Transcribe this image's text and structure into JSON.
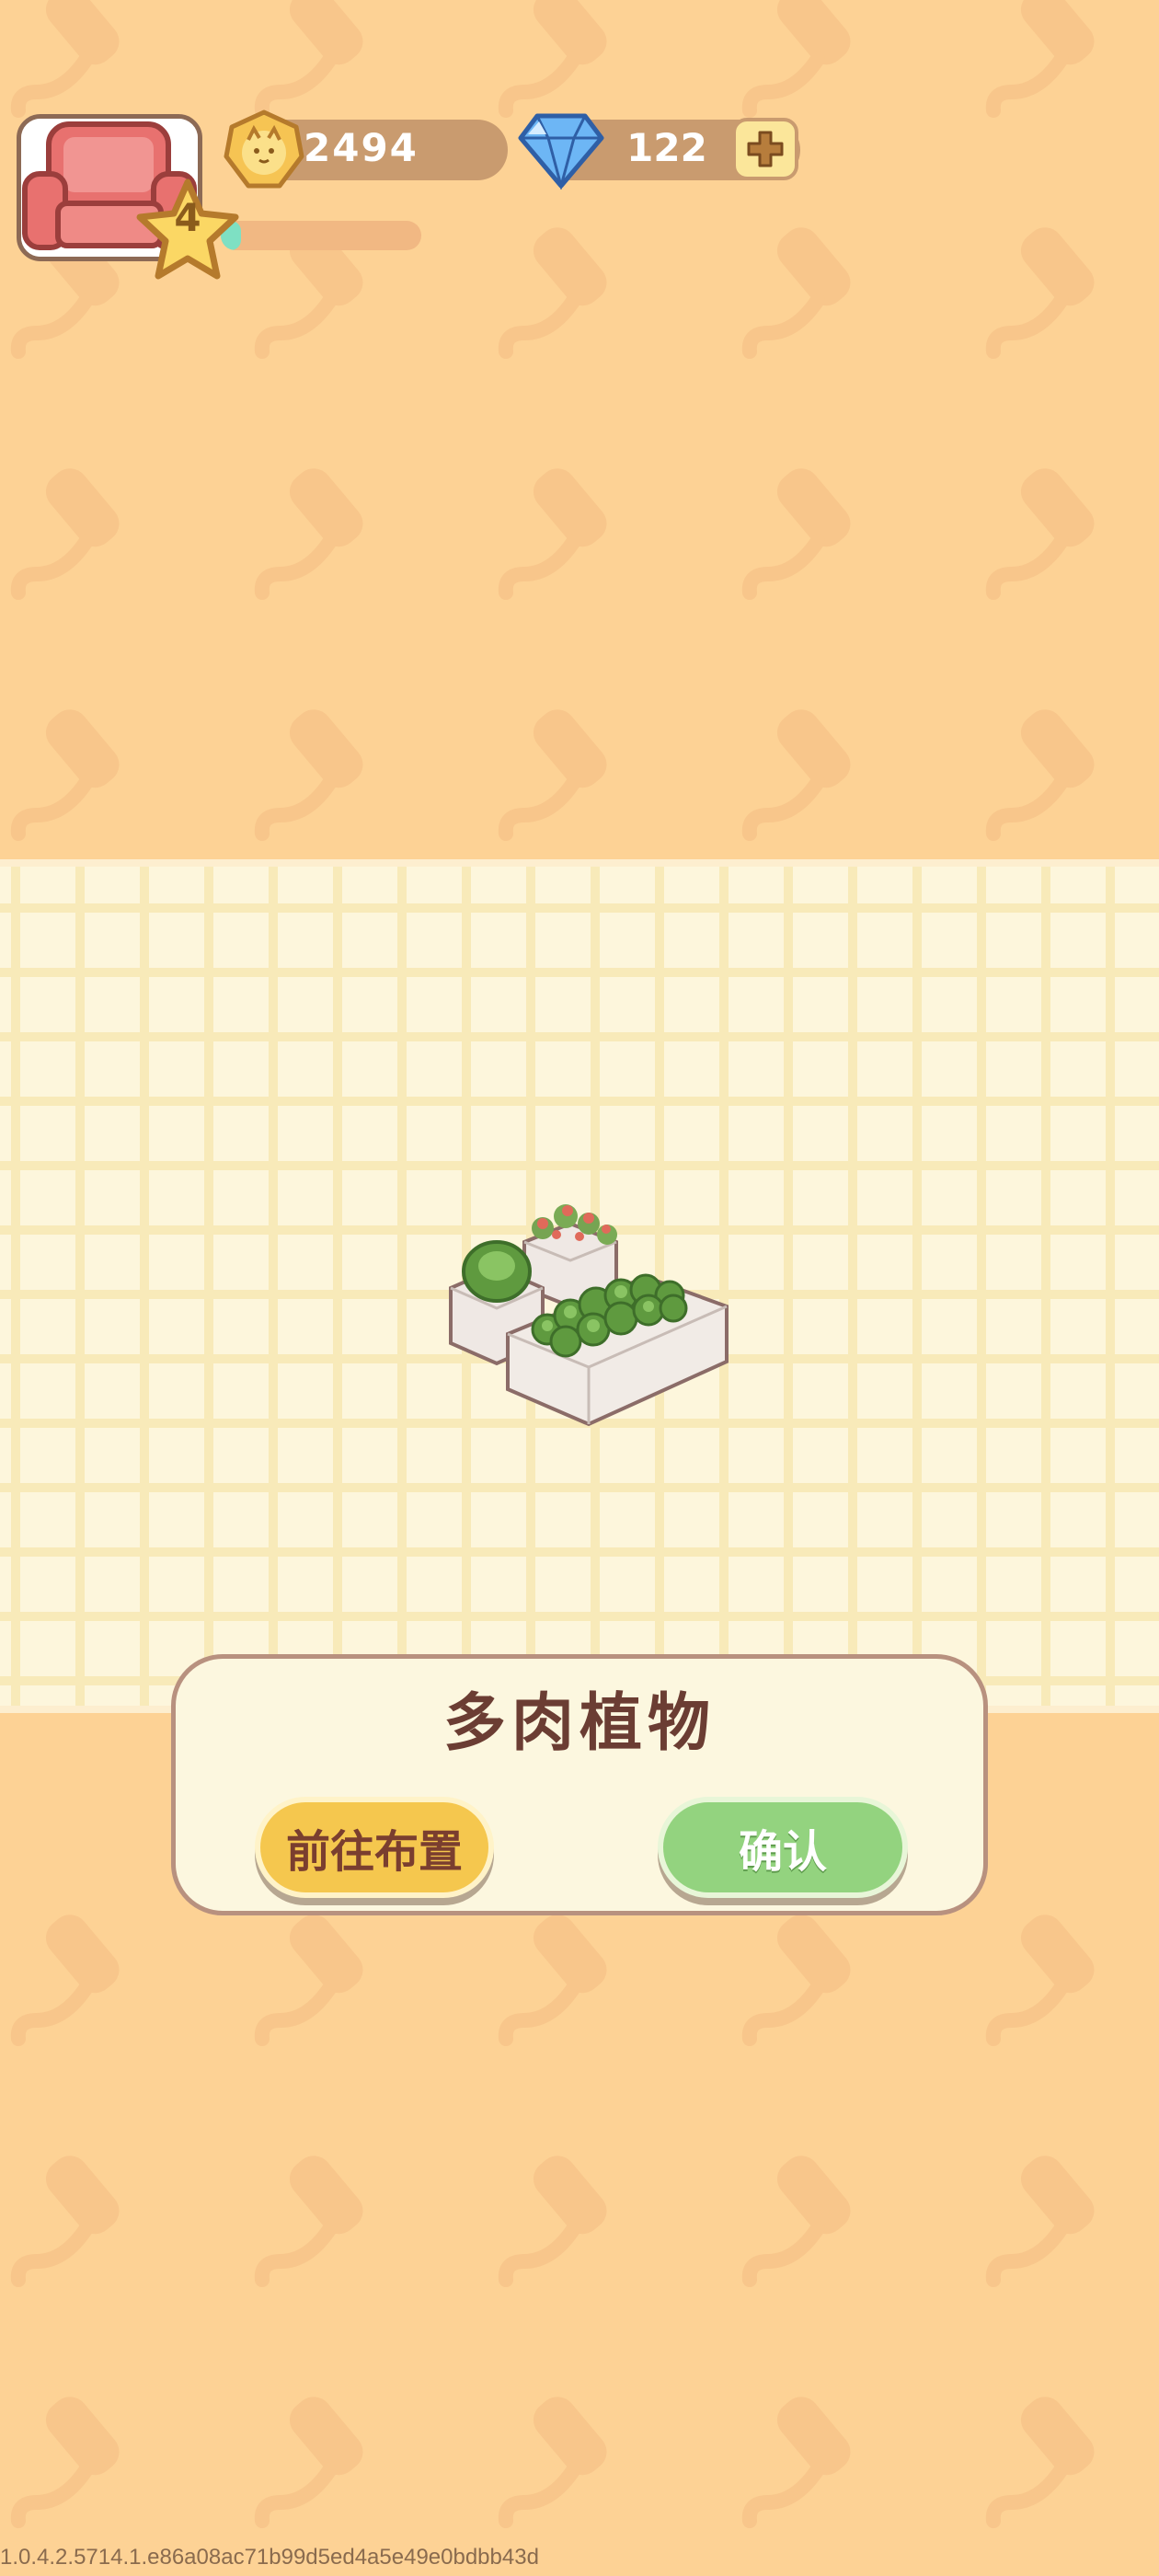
{
  "hud": {
    "level": "4",
    "xp_fraction": 0.1,
    "coins": "2494",
    "gems": "122",
    "avatar_icon": "armchair-icon",
    "coin_icon": "cat-coin-icon",
    "gem_icon": "diamond-icon",
    "add_icon": "plus-icon"
  },
  "dialog": {
    "item_name": "多肉植物",
    "goto_label": "前往布置",
    "confirm_label": "确认",
    "preview_icon": "succulent-planters-icon"
  },
  "footer": {
    "version": "1.0.4.2.5714.1.e86a08ac71b99d5ed4a5e49e0bdbb43d"
  },
  "colors": {
    "background": "#fdd295",
    "floor": "#fdf6dc",
    "goto_button": "#f5c74e",
    "confirm_button": "#93d37f",
    "title_text": "#6b3d33"
  }
}
